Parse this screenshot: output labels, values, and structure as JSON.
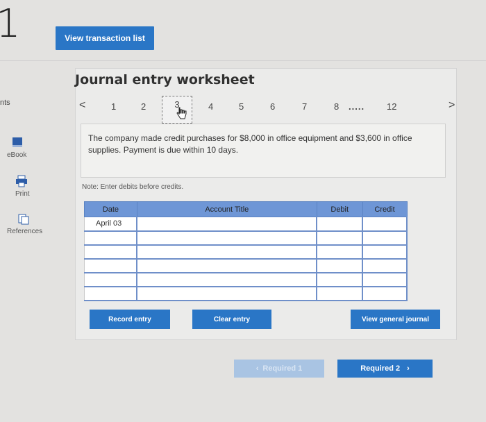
{
  "header": {
    "question_number": "1",
    "view_transactions_label": "View transaction list"
  },
  "sidebar": {
    "items": [
      {
        "label": "nts",
        "icon": "clipped-icon"
      },
      {
        "label": "eBook",
        "icon": "book-icon"
      },
      {
        "label": "Print",
        "icon": "printer-icon"
      },
      {
        "label": "References",
        "icon": "references-icon"
      }
    ]
  },
  "worksheet": {
    "title": "Journal entry worksheet",
    "pager": {
      "prev": "<",
      "pages": [
        "1",
        "2",
        "3",
        "4",
        "5",
        "6",
        "7",
        "8"
      ],
      "current": "3",
      "ellipsis": ".....",
      "last": "12",
      "next": ">"
    },
    "description": "The company made credit purchases for $8,000 in office equipment and $3,600 in office supplies. Payment is due within 10 days.",
    "note": "Note: Enter debits before credits.",
    "table": {
      "headers": {
        "date": "Date",
        "account": "Account Title",
        "debit": "Debit",
        "credit": "Credit"
      },
      "rows": [
        {
          "date": "April 03",
          "account": "",
          "debit": "",
          "credit": ""
        },
        {
          "date": "",
          "account": "",
          "debit": "",
          "credit": ""
        },
        {
          "date": "",
          "account": "",
          "debit": "",
          "credit": ""
        },
        {
          "date": "",
          "account": "",
          "debit": "",
          "credit": ""
        },
        {
          "date": "",
          "account": "",
          "debit": "",
          "credit": ""
        },
        {
          "date": "",
          "account": "",
          "debit": "",
          "credit": ""
        }
      ]
    },
    "buttons": {
      "record": "Record entry",
      "clear": "Clear entry",
      "view_journal": "View general journal"
    }
  },
  "bottom_nav": {
    "prev_label": "Required 1",
    "next_label": "Required 2"
  },
  "colors": {
    "accent": "#2a76c6",
    "table_header": "#6e96d6"
  }
}
